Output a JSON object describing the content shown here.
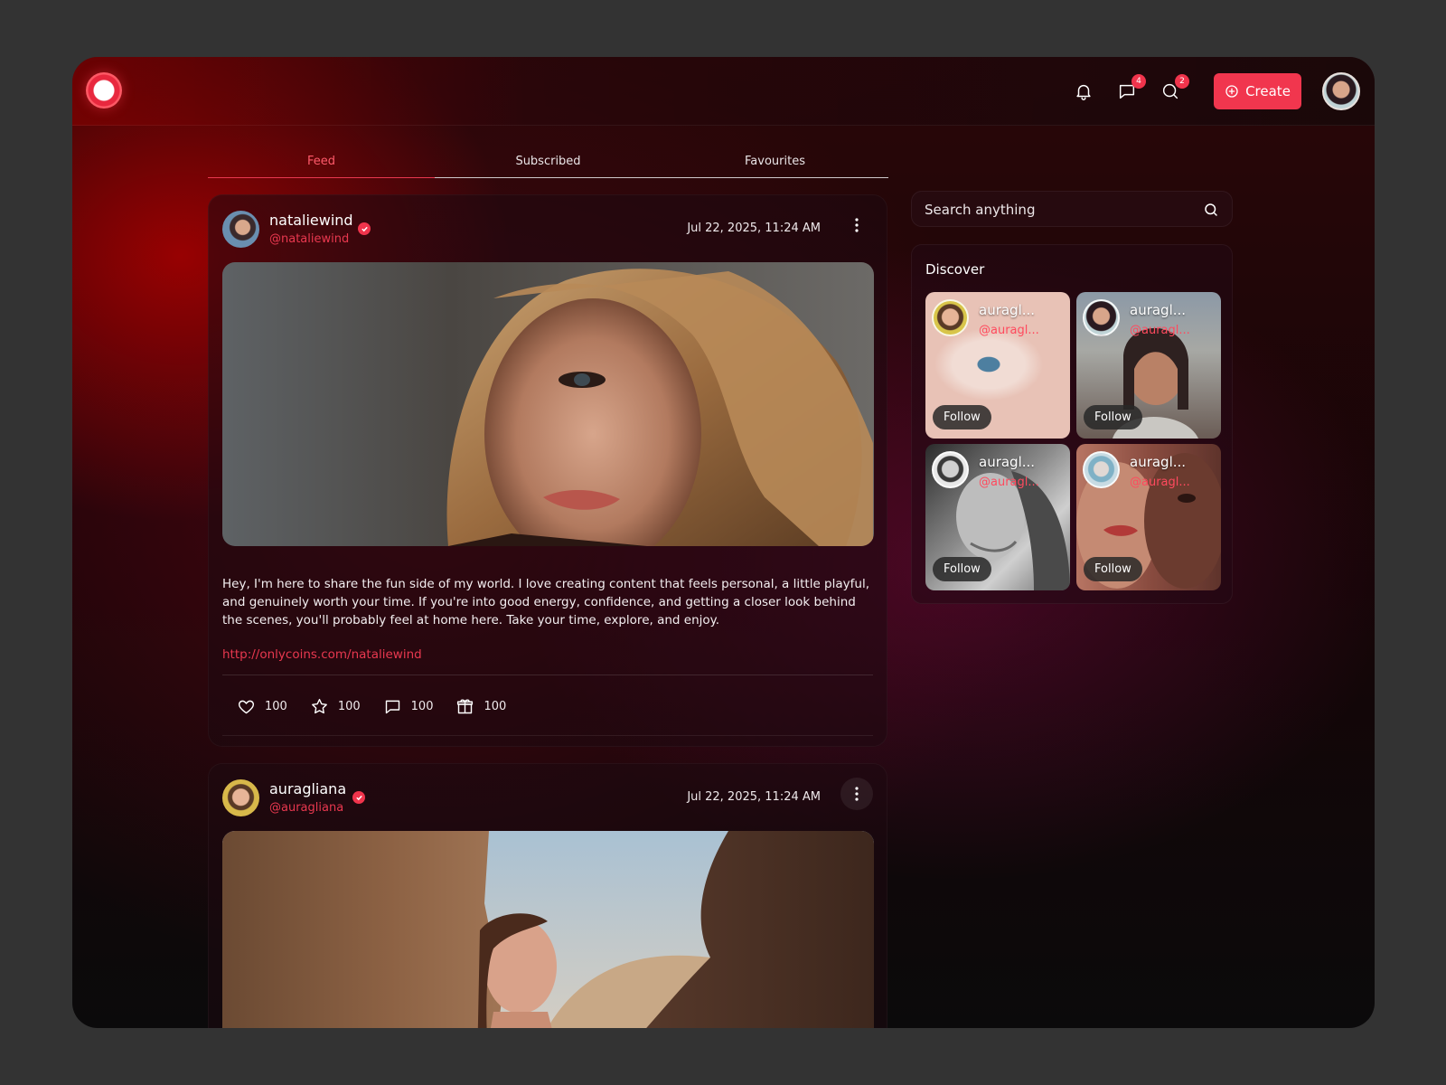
{
  "colors": {
    "accent": "#f1364e",
    "handle": "#e8384f",
    "bg": "#333333"
  },
  "topbar": {
    "create_label": "Create",
    "icons": [
      "bell-icon",
      "chat-icon",
      "search-chat-icon"
    ],
    "chat_badge": "4",
    "search_badge": "2"
  },
  "tabs": [
    {
      "label": "Feed",
      "active": true
    },
    {
      "label": "Subscribed",
      "active": false
    },
    {
      "label": "Favourites",
      "active": false
    }
  ],
  "posts": [
    {
      "username": "nataliewind",
      "handle": "@nataliewind",
      "time": "Jul 22, 2025, 11:24 AM",
      "text": "Hey, I'm here to share the fun side of my world. I love creating content that feels personal, a little playful, and genuinely worth your time. If you're into good energy, confidence, and getting a closer look behind the scenes, you'll probably feel at home here. Take your time, explore, and enjoy.",
      "link": "http://onlycoins.com/nataliewind",
      "likes": "100",
      "stars": "100",
      "comments": "100",
      "gifts": "100"
    },
    {
      "username": "auragliana",
      "handle": "@auragliana",
      "time": "Jul 22, 2025, 11:24 AM"
    }
  ],
  "search": {
    "placeholder": "Search anything"
  },
  "discover": {
    "title": "Discover",
    "cards": [
      {
        "name": "auragl...",
        "handle": "@auragl...",
        "follow": "Follow"
      },
      {
        "name": "auragl...",
        "handle": "@auragl...",
        "follow": "Follow"
      },
      {
        "name": "auragl...",
        "handle": "@auragl...",
        "follow": "Follow"
      },
      {
        "name": "auragl...",
        "handle": "@auragl...",
        "follow": "Follow"
      }
    ]
  }
}
